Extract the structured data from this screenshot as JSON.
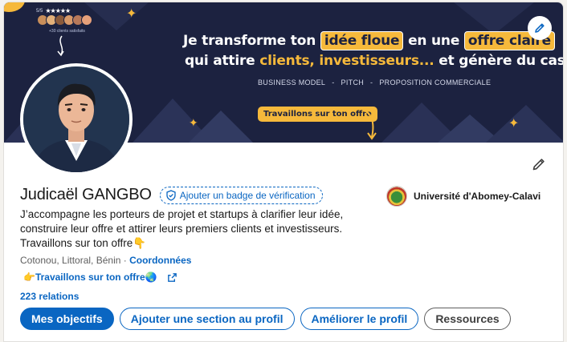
{
  "banner": {
    "line1_pre": "Je transforme ton",
    "line1_highlight1": "idée floue",
    "line1_mid": "en une",
    "line1_highlight2": "offre claire",
    "line2_pre": "qui attire ",
    "line2_highlight": "clients, investisseurs...",
    "line2_post": " et génère du cash.",
    "tags": [
      "BUSINESS MODEL",
      "-",
      "PITCH",
      "-",
      "PROPOSITION COMMERCIALE"
    ],
    "cta": "Travaillons sur ton offre",
    "stars_prefix": "5/5",
    "stars": "★★★★★",
    "clients_small": "+30 clients satisfaits",
    "colors": {
      "background": "#1c2240",
      "accent": "#f6b93b"
    }
  },
  "profile": {
    "name": "Judicaël GANGBO",
    "verify_badge": "Ajouter un badge de vérification",
    "headline": "J’accompagne les porteurs de projet et startups à clarifier leur idée, construire leur offre et attirer leurs premiers clients et investisseurs. Travaillons sur ton offre👇",
    "location": "Cotonou, Littoral, Bénin",
    "separator": "·",
    "contact_link": "Coordonnées",
    "website_link": "👉Travaillons sur ton offre🌏",
    "relations": "223 relations",
    "university": "Université d'Abomey-Calavi"
  },
  "actions": {
    "objectives": "Mes objectifs",
    "add_section": "Ajouter une section au profil",
    "improve": "Améliorer le profil",
    "resources": "Ressources"
  },
  "icons": {
    "cover_edit": "pencil-icon",
    "intro_edit": "pencil-icon",
    "verify": "shield-check-icon",
    "external_link": "external-link-icon"
  },
  "colors": {
    "linkedin_blue": "#0a66c2",
    "text": "#191919",
    "muted": "#5e5e5e"
  }
}
